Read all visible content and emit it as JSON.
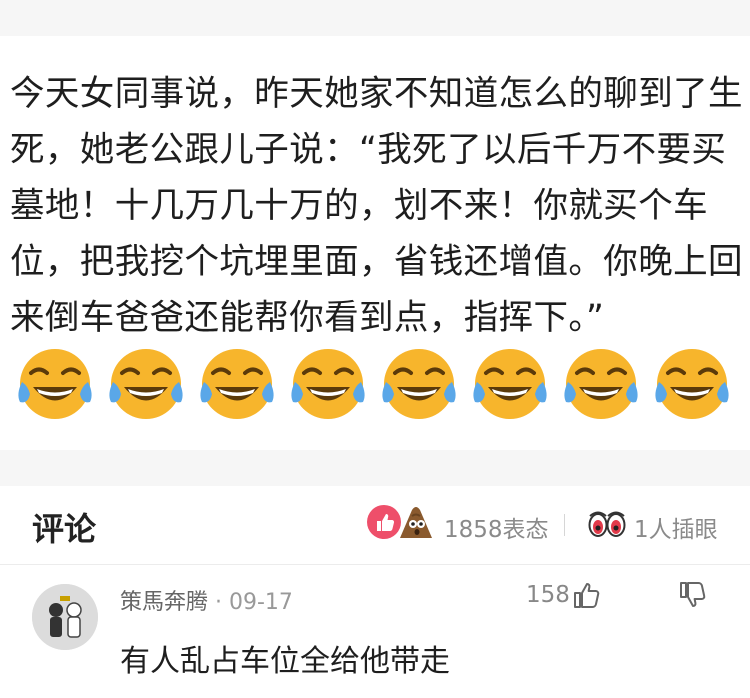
{
  "post": {
    "text": "今天女同事说，昨天她家不知道怎么的聊到了生死，她老公跟儿子说：“我死了以后千万不要买墓地！十几万几十万的，划不来！你就买个车位，把我挖个坑埋里面，省钱还增值。你晚上回来倒车爸爸还能帮你看到点，指挥下。”",
    "emojis": [
      "laugh-cry-icon",
      "laugh-cry-icon",
      "laugh-cry-icon",
      "laugh-cry-icon",
      "laugh-cry-icon",
      "laugh-cry-icon",
      "laugh-cry-icon",
      "laugh-cry-icon"
    ]
  },
  "comments_section": {
    "title": "评论",
    "reactions_label": "1858表态",
    "eyes_label": "1人插眼",
    "comment": {
      "user": "策馬奔腾",
      "time": "· 09-17",
      "likes": "158",
      "text": "有人乱占车位全给他带走"
    }
  },
  "colors": {
    "emoji_yellow": "#f7b52c",
    "like_badge": "#ee4f6a",
    "eye_red": "#e23a4a"
  }
}
